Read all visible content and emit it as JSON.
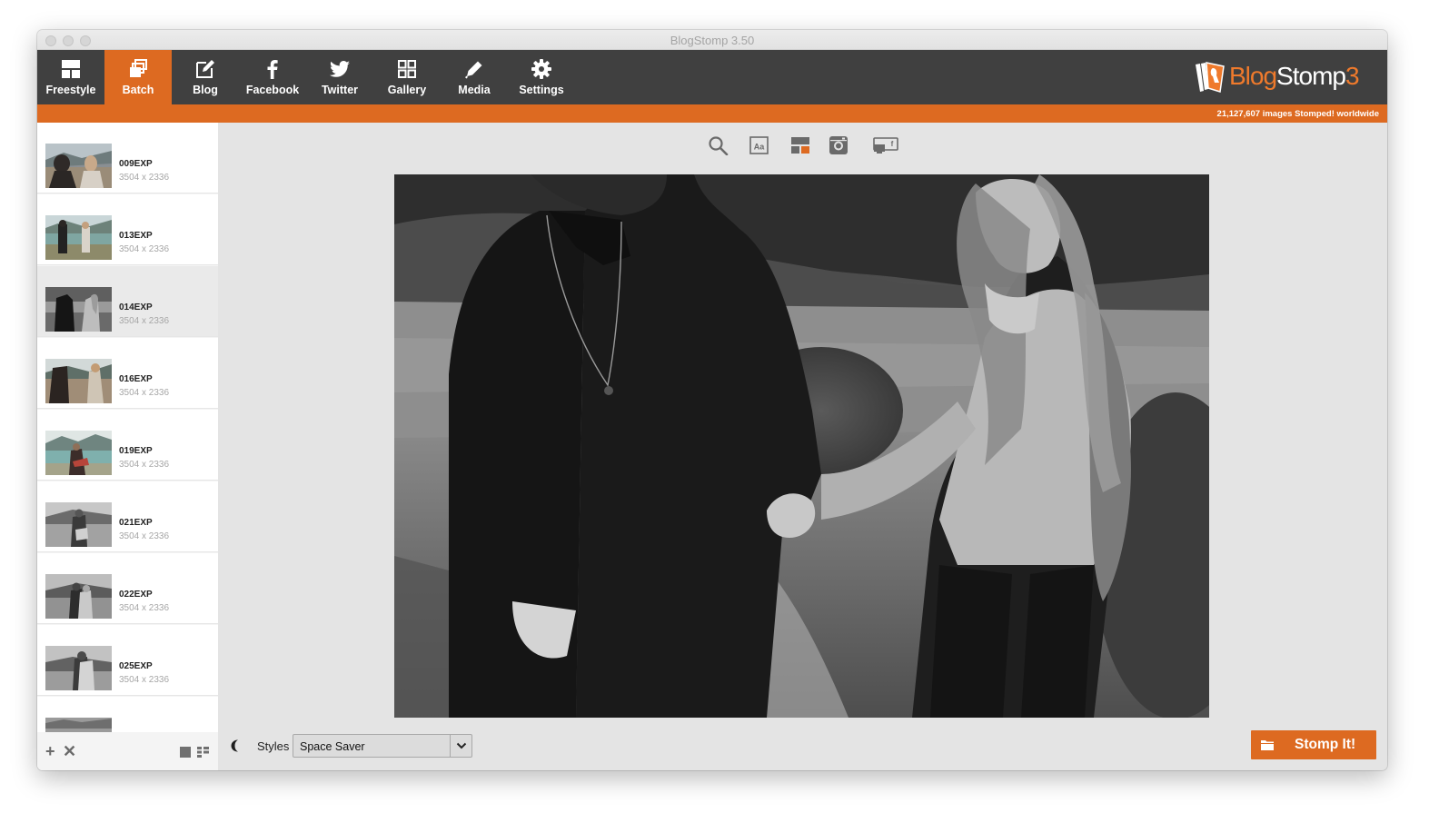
{
  "window": {
    "title": "BlogStomp 3.50"
  },
  "toolbar": {
    "items": [
      {
        "label": "Freestyle",
        "icon": "freestyle-layout-icon"
      },
      {
        "label": "Batch",
        "icon": "batch-stack-icon",
        "active": true
      },
      {
        "label": "Blog",
        "icon": "blog-edit-icon"
      },
      {
        "label": "Facebook",
        "icon": "facebook-icon"
      },
      {
        "label": "Twitter",
        "icon": "twitter-bird-icon"
      },
      {
        "label": "Gallery",
        "icon": "gallery-grid-icon"
      },
      {
        "label": "Media",
        "icon": "media-pencil-icon"
      },
      {
        "label": "Settings",
        "icon": "settings-gear-icon"
      }
    ]
  },
  "brand": {
    "part1": "Blog",
    "part2": "Stomp",
    "part3": "3"
  },
  "stats": {
    "text": "21,127,607 images Stomped! worldwide"
  },
  "images": [
    {
      "name": "009EXP",
      "dims": "3504 x 2336"
    },
    {
      "name": "013EXP",
      "dims": "3504 x 2336"
    },
    {
      "name": "014EXP",
      "dims": "3504 x 2336",
      "selected": true
    },
    {
      "name": "016EXP",
      "dims": "3504 x 2336"
    },
    {
      "name": "019EXP",
      "dims": "3504 x 2336"
    },
    {
      "name": "021EXP",
      "dims": "3504 x 2336"
    },
    {
      "name": "022EXP",
      "dims": "3504 x 2336"
    },
    {
      "name": "025EXP",
      "dims": "3504 x 2336"
    }
  ],
  "view_tools": [
    "zoom-icon",
    "text-overlay-icon",
    "layout-icon",
    "instagram-icon",
    "facebook-cover-icon"
  ],
  "bottom": {
    "styles_label": "Styles",
    "style_value": "Space Saver",
    "stomp_label": "Stomp It!"
  },
  "colors": {
    "accent": "#dd6a21",
    "toolbar": "#404040",
    "panel": "#e4e4e4"
  }
}
